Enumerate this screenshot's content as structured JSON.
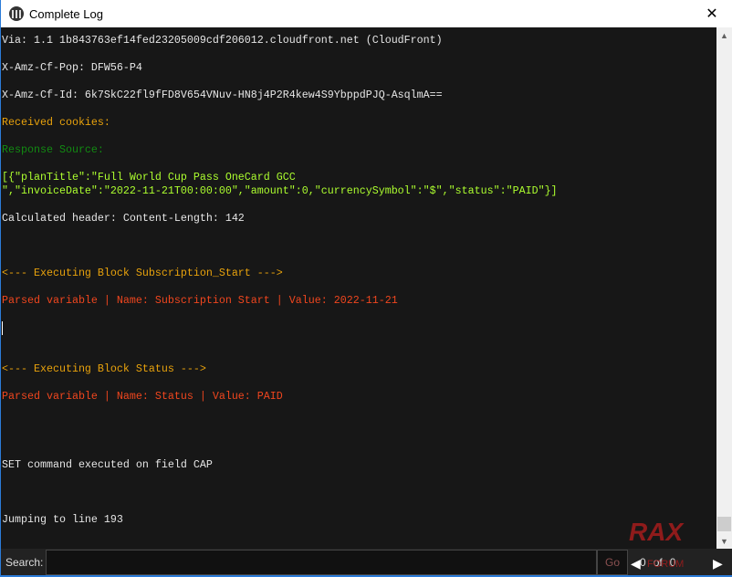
{
  "window": {
    "title": "Complete Log",
    "close": "✕"
  },
  "log": [
    {
      "text": "Via: 1.1 1b843763ef14fed23205009cdf206012.cloudfront.net (CloudFront)",
      "color": "white"
    },
    {
      "text": "",
      "color": "white"
    },
    {
      "text": "X-Amz-Cf-Pop: DFW56-P4",
      "color": "white"
    },
    {
      "text": "",
      "color": "white"
    },
    {
      "text": "X-Amz-Cf-Id: 6k7SkC22fl9fFD8V654VNuv-HN8j4P2R4kew4S9YbppdPJQ-AsqlmA==",
      "color": "white"
    },
    {
      "text": "",
      "color": "white"
    },
    {
      "text": "Received cookies:",
      "color": "orange"
    },
    {
      "text": "",
      "color": "white"
    },
    {
      "text": "Response Source:",
      "color": "green"
    },
    {
      "text": "",
      "color": "white"
    },
    {
      "text": "[{\"planTitle\":\"Full World Cup Pass OneCard GCC",
      "color": "json"
    },
    {
      "text": "\",\"invoiceDate\":\"2022-11-21T00:00:00\",\"amount\":0,\"currencySymbol\":\"$\",\"status\":\"PAID\"}]",
      "color": "json"
    },
    {
      "text": "",
      "color": "white"
    },
    {
      "text": "Calculated header: Content-Length: 142",
      "color": "white"
    },
    {
      "text": "",
      "color": "white"
    },
    {
      "text": "",
      "color": "white"
    },
    {
      "text": "",
      "color": "white"
    },
    {
      "text": "<--- Executing Block Subscription_Start --->",
      "color": "orange"
    },
    {
      "text": "",
      "color": "white"
    },
    {
      "text": "Parsed variable | Name: Subscription Start | Value: 2022-11-21",
      "color": "red"
    },
    {
      "text": "",
      "color": "white"
    },
    {
      "text": "",
      "color": "white",
      "cursor": true
    },
    {
      "text": "",
      "color": "white"
    },
    {
      "text": "",
      "color": "white"
    },
    {
      "text": "<--- Executing Block Status --->",
      "color": "orange"
    },
    {
      "text": "",
      "color": "white"
    },
    {
      "text": "Parsed variable | Name: Status | Value: PAID",
      "color": "red"
    },
    {
      "text": "",
      "color": "white"
    },
    {
      "text": "",
      "color": "white"
    },
    {
      "text": "",
      "color": "white"
    },
    {
      "text": "",
      "color": "white"
    },
    {
      "text": "SET command executed on field CAP",
      "color": "white"
    },
    {
      "text": "",
      "color": "white"
    },
    {
      "text": "",
      "color": "white"
    },
    {
      "text": "",
      "color": "white"
    },
    {
      "text": "Jumping to line 193",
      "color": "white"
    }
  ],
  "search": {
    "label": "Search:",
    "value": "",
    "go": "Go",
    "current": "0",
    "of": "of",
    "total": "0"
  },
  "watermark": {
    "text": "RAX",
    "sub": "FORUM"
  },
  "colors": {
    "white": "#e6e6e6",
    "orange": "#e8a20c",
    "green": "#128a12",
    "json": "#adff2f",
    "red": "#f0461e",
    "accent": "#2b7bd8"
  }
}
